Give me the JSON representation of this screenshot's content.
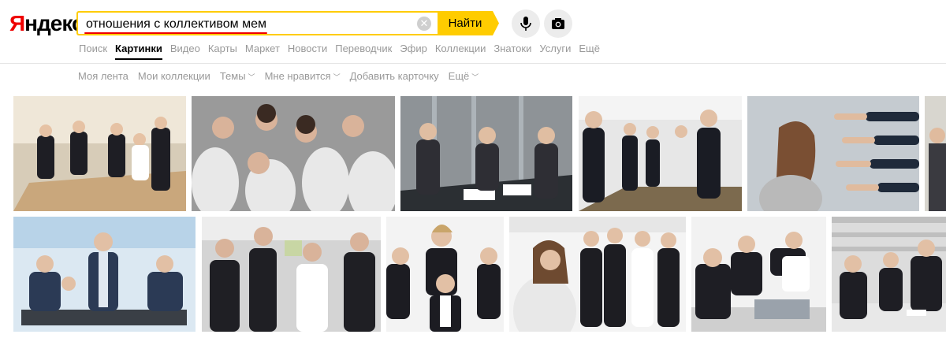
{
  "logo": {
    "first": "Я",
    "rest": "ндекс"
  },
  "search": {
    "query": "отношения с коллективом мем",
    "button_label": "Найти"
  },
  "tabs": [
    {
      "label": "Поиск",
      "active": false
    },
    {
      "label": "Картинки",
      "active": true
    },
    {
      "label": "Видео",
      "active": false
    },
    {
      "label": "Карты",
      "active": false
    },
    {
      "label": "Маркет",
      "active": false
    },
    {
      "label": "Новости",
      "active": false
    },
    {
      "label": "Переводчик",
      "active": false
    },
    {
      "label": "Эфир",
      "active": false
    },
    {
      "label": "Коллекции",
      "active": false
    },
    {
      "label": "Знатоки",
      "active": false
    },
    {
      "label": "Услуги",
      "active": false
    },
    {
      "label": "Ещё",
      "active": false
    }
  ],
  "subnav": [
    {
      "label": "Моя лента",
      "dropdown": false
    },
    {
      "label": "Мои коллекции",
      "dropdown": false
    },
    {
      "label": "Темы",
      "dropdown": true
    },
    {
      "label": "Мне нравится",
      "dropdown": true
    },
    {
      "label": "Добавить карточку",
      "dropdown": false
    },
    {
      "label": "Ещё",
      "dropdown": true
    }
  ],
  "colors": {
    "accent": "#ffcc00",
    "logo_red": "#ee0000",
    "underline_red": "#ee0000",
    "muted_text": "#999999"
  },
  "icons": {
    "clear": "close-circle-icon",
    "voice": "microphone-icon",
    "camera": "camera-icon"
  }
}
